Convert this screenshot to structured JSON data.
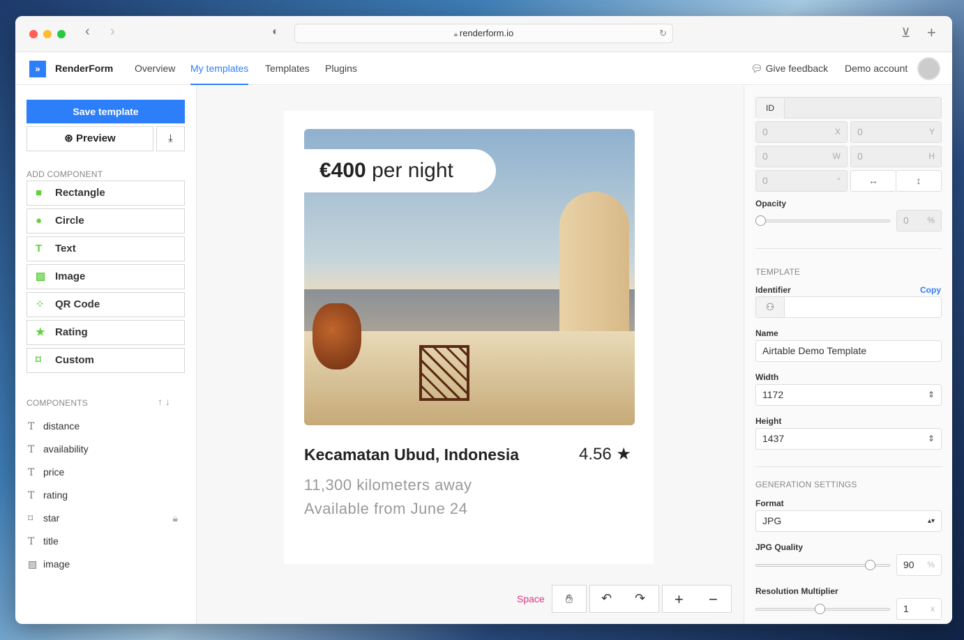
{
  "browser": {
    "url": "renderform.io"
  },
  "nav": {
    "brand": "RenderForm",
    "items": [
      "Overview",
      "My templates",
      "Templates",
      "Plugins"
    ],
    "active": "My templates",
    "feedback": "Give feedback",
    "account": "Demo account"
  },
  "left": {
    "save": "Save template",
    "preview": "Preview",
    "add_component_title": "ADD COMPONENT",
    "add_components": [
      {
        "label": "Rectangle",
        "icon": "square-icon"
      },
      {
        "label": "Circle",
        "icon": "circle-icon"
      },
      {
        "label": "Text",
        "icon": "text-icon"
      },
      {
        "label": "Image",
        "icon": "image-icon"
      },
      {
        "label": "QR Code",
        "icon": "qr-code-icon"
      },
      {
        "label": "Rating",
        "icon": "star-icon"
      },
      {
        "label": "Custom",
        "icon": "custom-shape-icon"
      }
    ],
    "components_title": "COMPONENTS",
    "components": [
      {
        "label": "distance",
        "icon": "text-icon"
      },
      {
        "label": "availability",
        "icon": "text-icon"
      },
      {
        "label": "price",
        "icon": "text-icon"
      },
      {
        "label": "rating",
        "icon": "text-icon"
      },
      {
        "label": "star",
        "icon": "custom-shape-icon",
        "locked": true
      },
      {
        "label": "title",
        "icon": "text-icon"
      },
      {
        "label": "image",
        "icon": "image-icon"
      }
    ]
  },
  "canvas": {
    "price_bold": "€400",
    "price_rest": " per night",
    "title": "Kecamatan Ubud, Indonesia",
    "rating": "4.56",
    "distance": "11,300 kilometers away",
    "availability": "Available from June 24",
    "space_label": "Space"
  },
  "props": {
    "id_label": "ID",
    "x": "0",
    "x_unit": "X",
    "y": "0",
    "y_unit": "Y",
    "w": "0",
    "w_unit": "W",
    "h": "0",
    "h_unit": "H",
    "rot": "0",
    "rot_unit": "°",
    "opacity_label": "Opacity",
    "opacity": "0",
    "pct": "%"
  },
  "template": {
    "title": "TEMPLATE",
    "identifier_label": "Identifier",
    "copy": "Copy",
    "name_label": "Name",
    "name": "Airtable Demo Template",
    "width_label": "Width",
    "width": "1172",
    "height_label": "Height",
    "height": "1437"
  },
  "generation": {
    "title": "GENERATION SETTINGS",
    "format_label": "Format",
    "format": "JPG",
    "quality_label": "JPG Quality",
    "quality": "90",
    "quality_fraction": 0.9,
    "resolution_label": "Resolution Multiplier",
    "resolution": "1",
    "resolution_unit": "x",
    "opacity_fraction": 0
  },
  "colors": {
    "accent": "#2d7ff9",
    "component_icon": "#5fd13a",
    "space": "#e0357f"
  }
}
